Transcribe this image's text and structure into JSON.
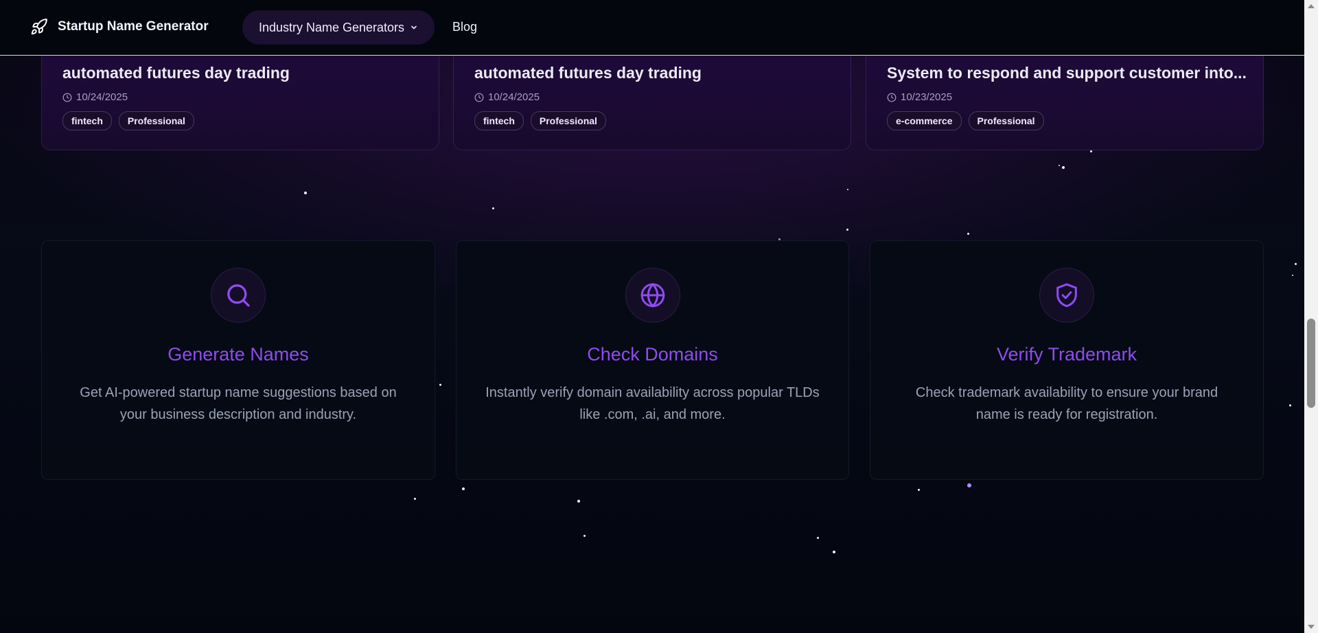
{
  "header": {
    "brand_name": "Startup Name Generator",
    "nav_dropdown_label": "Industry Name Generators",
    "nav_blog_label": "Blog"
  },
  "recent_names": [
    {
      "title": "automated futures day trading",
      "date": "10/24/2025",
      "tags": [
        "fintech",
        "Professional"
      ]
    },
    {
      "title": "automated futures day trading",
      "date": "10/24/2025",
      "tags": [
        "fintech",
        "Professional"
      ]
    },
    {
      "title": "System to respond and support customer into...",
      "date": "10/23/2025",
      "tags": [
        "e-commerce",
        "Professional"
      ]
    }
  ],
  "features": [
    {
      "icon": "search-icon",
      "title": "Generate Names",
      "description": "Get AI-powered startup name suggestions based on your business description and industry."
    },
    {
      "icon": "globe-icon",
      "title": "Check Domains",
      "description": "Instantly verify domain availability across popular TLDs like .com, .ai, and more."
    },
    {
      "icon": "shield-check-icon",
      "title": "Verify Trademark",
      "description": "Check trademark availability to ensure your brand name is ready for registration."
    }
  ],
  "colors": {
    "accent": "#8f4bf0",
    "background": "#050814",
    "card_purple": "#1f0a3a"
  }
}
